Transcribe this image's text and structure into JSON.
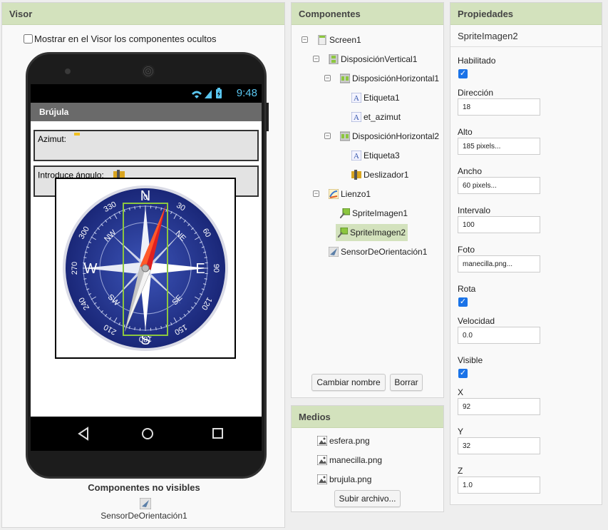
{
  "visor": {
    "title": "Visor",
    "show_hidden_label": "Mostrar en el Visor los componentes ocultos",
    "status_time": "9:48",
    "app_title": "Brújula",
    "azimut_label": "Azimut:",
    "angle_label": "Introduce ángulo:",
    "compass_letters": {
      "n": "N",
      "s": "S",
      "e": "E",
      "w": "W",
      "ne": "NE",
      "nw": "NW",
      "se": "SE",
      "sw": "SW"
    },
    "compass_degrees": [
      "0",
      "30",
      "60",
      "90",
      "120",
      "150",
      "180",
      "210",
      "240",
      "270",
      "300",
      "330"
    ],
    "nonvisible_title": "Componentes no visibles",
    "nonvisible_item": "SensorDeOrientación1"
  },
  "components": {
    "title": "Componentes",
    "tree": [
      {
        "label": "Screen1",
        "icon": "screen-icon"
      },
      {
        "label": "DisposiciónVertical1",
        "icon": "vertical-arrangement-icon"
      },
      {
        "label": "DisposiciónHorizontal1",
        "icon": "horizontal-arrangement-icon"
      },
      {
        "label": "Etiqueta1",
        "icon": "label-icon"
      },
      {
        "label": "et_azimut",
        "icon": "label-icon"
      },
      {
        "label": "DisposiciónHorizontal2",
        "icon": "horizontal-arrangement-icon"
      },
      {
        "label": "Etiqueta3",
        "icon": "label-icon"
      },
      {
        "label": "Deslizador1",
        "icon": "slider-icon"
      },
      {
        "label": "Lienzo1",
        "icon": "canvas-icon"
      },
      {
        "label": "SpriteImagen1",
        "icon": "sprite-icon"
      },
      {
        "label": "SpriteImagen2",
        "icon": "sprite-icon"
      },
      {
        "label": "SensorDeOrientación1",
        "icon": "orientation-sensor-icon"
      }
    ],
    "rename_button": "Cambiar nombre",
    "delete_button": "Borrar"
  },
  "media": {
    "title": "Medios",
    "files": [
      "esfera.png",
      "manecilla.png",
      "brujula.png"
    ],
    "upload_button": "Subir archivo..."
  },
  "properties": {
    "title": "Propiedades",
    "component": "SpriteImagen2",
    "habilitado_label": "Habilitado",
    "direccion_label": "Dirección",
    "direccion_value": "18",
    "alto_label": "Alto",
    "alto_value": "185 pixels...",
    "ancho_label": "Ancho",
    "ancho_value": "60 pixels...",
    "intervalo_label": "Intervalo",
    "intervalo_value": "100",
    "foto_label": "Foto",
    "foto_value": "manecilla.png...",
    "rota_label": "Rota",
    "velocidad_label": "Velocidad",
    "velocidad_value": "0.0",
    "visible_label": "Visible",
    "x_label": "X",
    "x_value": "92",
    "y_label": "Y",
    "y_value": "32",
    "z_label": "Z",
    "z_value": "1.0"
  },
  "colors": {
    "panel_header": "#d3e2bd",
    "selection": "#d3e2bd",
    "checkbox": "#1a73e8",
    "compass_blue": "#23348f",
    "needle_red": "#e02020",
    "status_blue": "#5ac6f0"
  }
}
